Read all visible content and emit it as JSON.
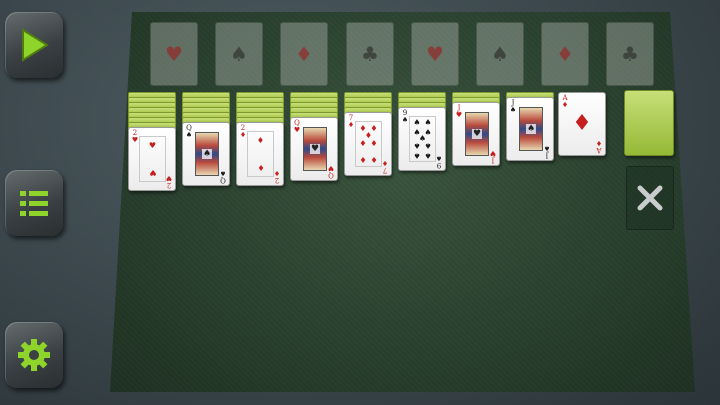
{
  "sidebar": {
    "buttons": [
      {
        "name": "play-button",
        "icon": "play-icon"
      },
      {
        "name": "menu-button",
        "icon": "menu-icon"
      },
      {
        "name": "settings-button",
        "icon": "gear-icon"
      }
    ],
    "accent": "#8ed42a"
  },
  "foundations": [
    {
      "suit": "♥",
      "color": "red"
    },
    {
      "suit": "♠",
      "color": "black"
    },
    {
      "suit": "♦",
      "color": "red"
    },
    {
      "suit": "♣",
      "color": "black"
    },
    {
      "suit": "♥",
      "color": "red"
    },
    {
      "suit": "♠",
      "color": "black"
    },
    {
      "suit": "♦",
      "color": "red"
    },
    {
      "suit": "♣",
      "color": "black"
    }
  ],
  "tableau": [
    {
      "hidden": 7,
      "top": {
        "rank": "2",
        "suit": "♥",
        "color": "red",
        "type": "pip",
        "count": 2
      }
    },
    {
      "hidden": 6,
      "top": {
        "rank": "Q",
        "suit": "♠",
        "color": "black",
        "type": "court"
      }
    },
    {
      "hidden": 6,
      "top": {
        "rank": "2",
        "suit": "♦",
        "color": "red",
        "type": "pip",
        "count": 2
      }
    },
    {
      "hidden": 5,
      "top": {
        "rank": "Q",
        "suit": "♥",
        "color": "red",
        "type": "court"
      }
    },
    {
      "hidden": 4,
      "top": {
        "rank": "7",
        "suit": "♦",
        "color": "red",
        "type": "pip",
        "count": 7
      }
    },
    {
      "hidden": 3,
      "top": {
        "rank": "9",
        "suit": "♠",
        "color": "black",
        "type": "pip",
        "count": 9
      }
    },
    {
      "hidden": 2,
      "top": {
        "rank": "J",
        "suit": "♥",
        "color": "red",
        "type": "court"
      }
    },
    {
      "hidden": 1,
      "top": {
        "rank": "J",
        "suit": "♠",
        "color": "black",
        "type": "court"
      }
    },
    {
      "hidden": 0,
      "top": {
        "rank": "A",
        "suit": "♦",
        "color": "red",
        "type": "ace",
        "count": 1
      }
    }
  ],
  "stock": {
    "remaining": true
  },
  "empty_stock_icon": "close-icon"
}
